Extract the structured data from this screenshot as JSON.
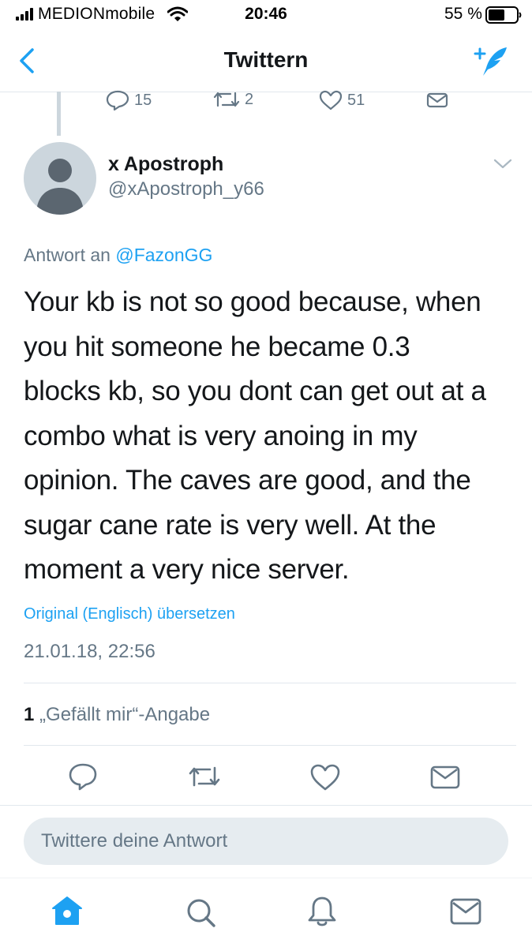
{
  "status_bar": {
    "carrier": "MEDIONmobile",
    "time": "20:46",
    "battery": "55 %"
  },
  "nav": {
    "title": "Twittern",
    "back_icon": "chevron-left-icon",
    "compose_icon": "compose-tweet-icon"
  },
  "previous_tweet": {
    "replies": "15",
    "retweets": "2",
    "likes": "51"
  },
  "tweet": {
    "display_name": "x Apostroph",
    "handle": "@xApostroph_y66",
    "reply_prefix": "Antwort an",
    "reply_to": "@FazonGG",
    "lines": [
      "Your kb is not so good because, when",
      "you hit someone he became 0.3",
      "blocks kb, so you dont can get out at a",
      "combo what is very anoing in my",
      "opinion. The caves are good, and the",
      "sugar cane rate is very well. At the",
      "moment a very nice server."
    ],
    "translate": "Original (Englisch) übersetzen",
    "timestamp": "21.01.18, 22:56",
    "like_count": "1",
    "like_label": "„Gefällt mir“-Angabe"
  },
  "reply_placeholder": "Twittere deine Antwort",
  "colors": {
    "accent": "#1da1f2",
    "secondary_text": "#657786",
    "divider": "#e1e8ed",
    "reply_box": "#e6ecf0"
  },
  "tab_bar": [
    "home-icon",
    "search-icon",
    "notifications-icon",
    "messages-icon"
  ]
}
